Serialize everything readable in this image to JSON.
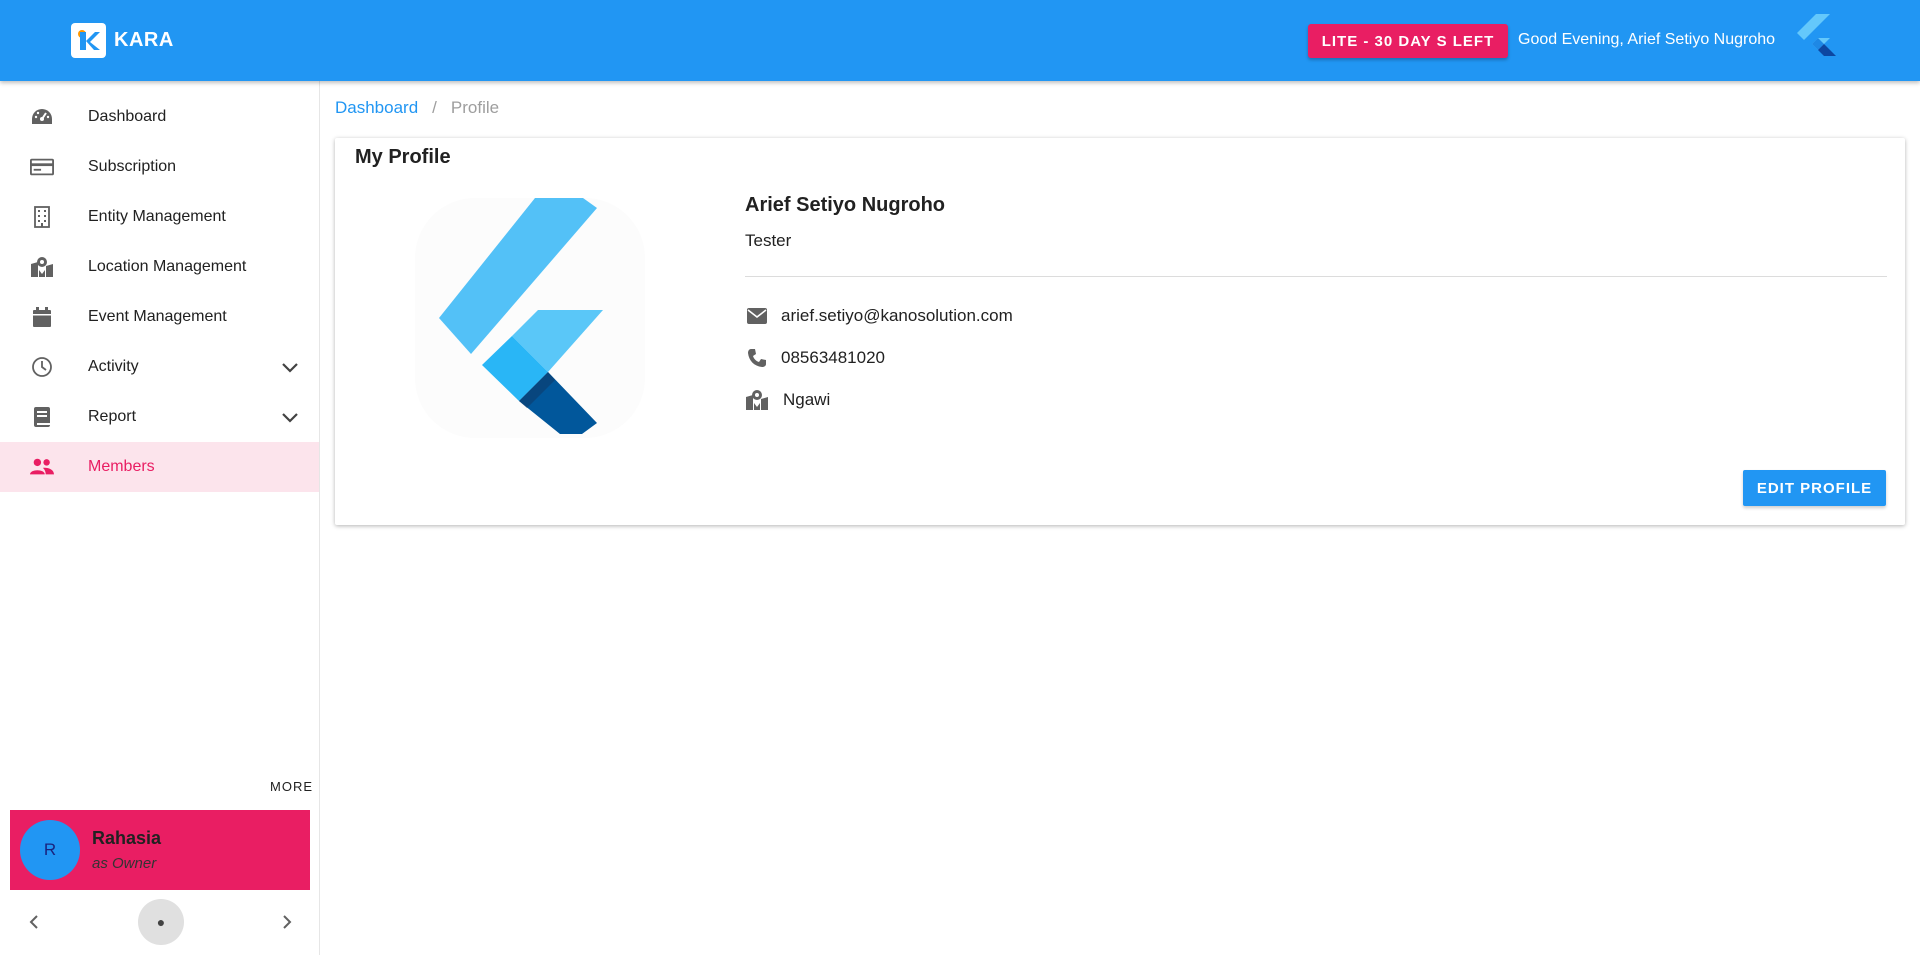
{
  "header": {
    "brand_name": "KARA",
    "trial_badge": "LITE - 30 DAY S LEFT",
    "greeting": "Good Evening, Arief Setiyo Nugroho",
    "brand_color": "#2196f3",
    "accent_color": "#e91e63"
  },
  "sidebar": {
    "items": [
      {
        "label": "Dashboard",
        "icon": "dashboard-gauge-icon"
      },
      {
        "label": "Subscription",
        "icon": "credit-card-icon"
      },
      {
        "label": "Entity Management",
        "icon": "building-icon"
      },
      {
        "label": "Location Management",
        "icon": "map-marker-icon"
      },
      {
        "label": "Event Management",
        "icon": "calendar-icon"
      },
      {
        "label": "Activity",
        "icon": "clock-icon",
        "expandable": true
      },
      {
        "label": "Report",
        "icon": "book-icon",
        "expandable": true
      },
      {
        "label": "Members",
        "icon": "people-icon",
        "active": true
      }
    ],
    "more_label": "MORE",
    "account": {
      "initial": "R",
      "name": "Rahasia",
      "role": "as Owner"
    },
    "pager_dot": "●"
  },
  "breadcrumb": {
    "home": "Dashboard",
    "separator": "/",
    "current": "Profile"
  },
  "profile": {
    "card_title": "My Profile",
    "name": "Arief Setiyo Nugroho",
    "role": "Tester",
    "email": "arief.setiyo@kanosolution.com",
    "phone": "08563481020",
    "location": "Ngawi",
    "edit_button": "EDIT PROFILE"
  }
}
